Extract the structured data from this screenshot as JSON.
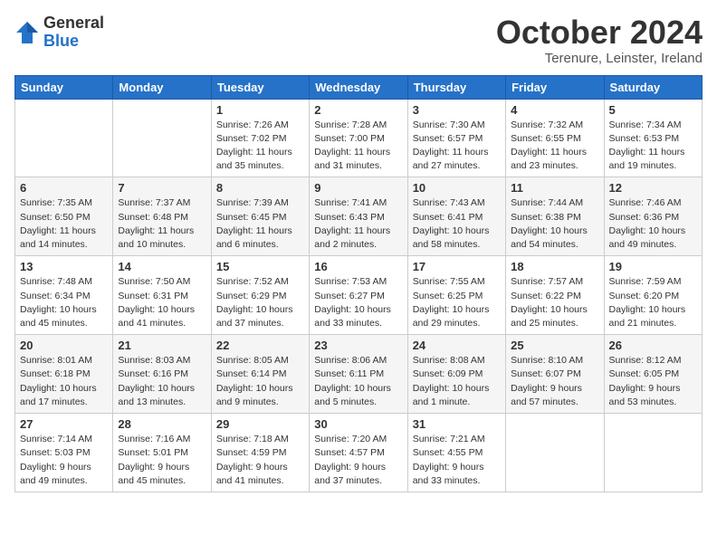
{
  "logo": {
    "general": "General",
    "blue": "Blue"
  },
  "title": "October 2024",
  "subtitle": "Terenure, Leinster, Ireland",
  "days_of_week": [
    "Sunday",
    "Monday",
    "Tuesday",
    "Wednesday",
    "Thursday",
    "Friday",
    "Saturday"
  ],
  "weeks": [
    [
      {
        "day": "",
        "info": ""
      },
      {
        "day": "",
        "info": ""
      },
      {
        "day": "1",
        "info": "Sunrise: 7:26 AM\nSunset: 7:02 PM\nDaylight: 11 hours and 35 minutes."
      },
      {
        "day": "2",
        "info": "Sunrise: 7:28 AM\nSunset: 7:00 PM\nDaylight: 11 hours and 31 minutes."
      },
      {
        "day": "3",
        "info": "Sunrise: 7:30 AM\nSunset: 6:57 PM\nDaylight: 11 hours and 27 minutes."
      },
      {
        "day": "4",
        "info": "Sunrise: 7:32 AM\nSunset: 6:55 PM\nDaylight: 11 hours and 23 minutes."
      },
      {
        "day": "5",
        "info": "Sunrise: 7:34 AM\nSunset: 6:53 PM\nDaylight: 11 hours and 19 minutes."
      }
    ],
    [
      {
        "day": "6",
        "info": "Sunrise: 7:35 AM\nSunset: 6:50 PM\nDaylight: 11 hours and 14 minutes."
      },
      {
        "day": "7",
        "info": "Sunrise: 7:37 AM\nSunset: 6:48 PM\nDaylight: 11 hours and 10 minutes."
      },
      {
        "day": "8",
        "info": "Sunrise: 7:39 AM\nSunset: 6:45 PM\nDaylight: 11 hours and 6 minutes."
      },
      {
        "day": "9",
        "info": "Sunrise: 7:41 AM\nSunset: 6:43 PM\nDaylight: 11 hours and 2 minutes."
      },
      {
        "day": "10",
        "info": "Sunrise: 7:43 AM\nSunset: 6:41 PM\nDaylight: 10 hours and 58 minutes."
      },
      {
        "day": "11",
        "info": "Sunrise: 7:44 AM\nSunset: 6:38 PM\nDaylight: 10 hours and 54 minutes."
      },
      {
        "day": "12",
        "info": "Sunrise: 7:46 AM\nSunset: 6:36 PM\nDaylight: 10 hours and 49 minutes."
      }
    ],
    [
      {
        "day": "13",
        "info": "Sunrise: 7:48 AM\nSunset: 6:34 PM\nDaylight: 10 hours and 45 minutes."
      },
      {
        "day": "14",
        "info": "Sunrise: 7:50 AM\nSunset: 6:31 PM\nDaylight: 10 hours and 41 minutes."
      },
      {
        "day": "15",
        "info": "Sunrise: 7:52 AM\nSunset: 6:29 PM\nDaylight: 10 hours and 37 minutes."
      },
      {
        "day": "16",
        "info": "Sunrise: 7:53 AM\nSunset: 6:27 PM\nDaylight: 10 hours and 33 minutes."
      },
      {
        "day": "17",
        "info": "Sunrise: 7:55 AM\nSunset: 6:25 PM\nDaylight: 10 hours and 29 minutes."
      },
      {
        "day": "18",
        "info": "Sunrise: 7:57 AM\nSunset: 6:22 PM\nDaylight: 10 hours and 25 minutes."
      },
      {
        "day": "19",
        "info": "Sunrise: 7:59 AM\nSunset: 6:20 PM\nDaylight: 10 hours and 21 minutes."
      }
    ],
    [
      {
        "day": "20",
        "info": "Sunrise: 8:01 AM\nSunset: 6:18 PM\nDaylight: 10 hours and 17 minutes."
      },
      {
        "day": "21",
        "info": "Sunrise: 8:03 AM\nSunset: 6:16 PM\nDaylight: 10 hours and 13 minutes."
      },
      {
        "day": "22",
        "info": "Sunrise: 8:05 AM\nSunset: 6:14 PM\nDaylight: 10 hours and 9 minutes."
      },
      {
        "day": "23",
        "info": "Sunrise: 8:06 AM\nSunset: 6:11 PM\nDaylight: 10 hours and 5 minutes."
      },
      {
        "day": "24",
        "info": "Sunrise: 8:08 AM\nSunset: 6:09 PM\nDaylight: 10 hours and 1 minute."
      },
      {
        "day": "25",
        "info": "Sunrise: 8:10 AM\nSunset: 6:07 PM\nDaylight: 9 hours and 57 minutes."
      },
      {
        "day": "26",
        "info": "Sunrise: 8:12 AM\nSunset: 6:05 PM\nDaylight: 9 hours and 53 minutes."
      }
    ],
    [
      {
        "day": "27",
        "info": "Sunrise: 7:14 AM\nSunset: 5:03 PM\nDaylight: 9 hours and 49 minutes."
      },
      {
        "day": "28",
        "info": "Sunrise: 7:16 AM\nSunset: 5:01 PM\nDaylight: 9 hours and 45 minutes."
      },
      {
        "day": "29",
        "info": "Sunrise: 7:18 AM\nSunset: 4:59 PM\nDaylight: 9 hours and 41 minutes."
      },
      {
        "day": "30",
        "info": "Sunrise: 7:20 AM\nSunset: 4:57 PM\nDaylight: 9 hours and 37 minutes."
      },
      {
        "day": "31",
        "info": "Sunrise: 7:21 AM\nSunset: 4:55 PM\nDaylight: 9 hours and 33 minutes."
      },
      {
        "day": "",
        "info": ""
      },
      {
        "day": "",
        "info": ""
      }
    ]
  ]
}
